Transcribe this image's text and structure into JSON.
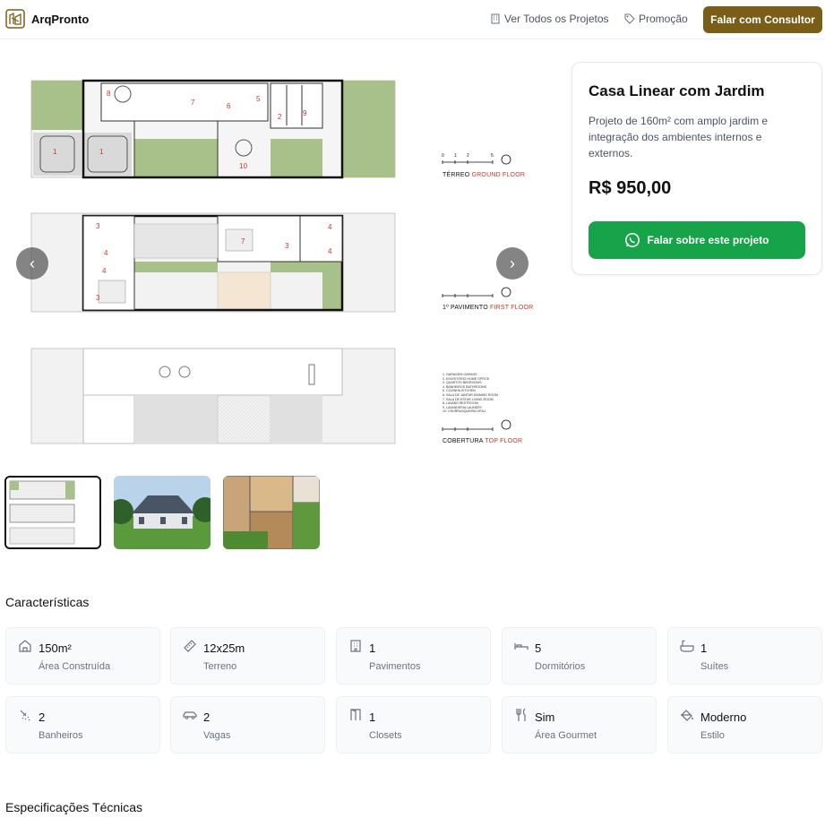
{
  "header": {
    "brand": "ArqPronto",
    "nav_all_projects": "Ver Todos os Projetos",
    "nav_promo": "Promoção",
    "cta": "Falar com Consultor"
  },
  "gallery": {
    "floors": [
      {
        "label": "TÉRREO",
        "label_en": "GROUND FLOOR"
      },
      {
        "label": "1º PAVIMENTO",
        "label_en": "FIRST FLOOR"
      },
      {
        "label": "COBERTURA",
        "label_en": "TOP FLOOR"
      }
    ],
    "room_numbers": {
      "ground": [
        "1",
        "1",
        "2",
        "5",
        "6",
        "7",
        "8",
        "9",
        "10"
      ],
      "first": [
        "3",
        "3",
        "3",
        "4",
        "4",
        "4",
        "4",
        "7"
      ]
    },
    "scale_ticks": [
      "0",
      "1",
      "2",
      "5"
    ],
    "legend": [
      "1. GARAGEM GARAGE",
      "2. ESCRITÓRIO HOME OFFICE",
      "3. QUARTOS BEDROOMS",
      "4. BANHEIROS BATHROOMS",
      "5. COZINHA KITCHEN",
      "6. SALA DE JANTAR DINNING ROOM",
      "7. SALA DE ESTAR LIVING ROOM",
      "8. LAVABO RESTROOM",
      "9. LAVANDERIA LAUNDRY",
      "10. CHURRASQUEIRA GRILL"
    ],
    "prev_icon": "chevron-left-icon",
    "next_icon": "chevron-right-icon",
    "active_thumbnail": 1
  },
  "product": {
    "title": "Casa Linear com Jardim",
    "description": "Projeto de 160m² com amplo jardim e integração dos ambientes internos e externos.",
    "price": "R$ 950,00",
    "whatsapp_button": "Falar sobre este projeto"
  },
  "features_title": "Características",
  "features": [
    {
      "icon": "home-icon",
      "value": "150m²",
      "label": "Área Construída"
    },
    {
      "icon": "ruler-icon",
      "value": "12x25m",
      "label": "Terreno"
    },
    {
      "icon": "building-icon",
      "value": "1",
      "label": "Pavimentos"
    },
    {
      "icon": "bed-icon",
      "value": "5",
      "label": "Dormitórios"
    },
    {
      "icon": "bath-icon",
      "value": "1",
      "label": "Suítes"
    },
    {
      "icon": "shower-icon",
      "value": "2",
      "label": "Banheiros"
    },
    {
      "icon": "car-icon",
      "value": "2",
      "label": "Vagas"
    },
    {
      "icon": "closet-icon",
      "value": "1",
      "label": "Closets"
    },
    {
      "icon": "utensils-icon",
      "value": "Sim",
      "label": "Área Gourmet"
    },
    {
      "icon": "paint-bucket-icon",
      "value": "Moderno",
      "label": "Estilo"
    }
  ],
  "specs_title": "Especificações Técnicas",
  "colors": {
    "brand": "#7a5d17",
    "whatsapp": "#16a34a",
    "plan_green": "#a8c08a",
    "plan_gray": "#d9d9d9",
    "label_red": "#c0392b"
  }
}
